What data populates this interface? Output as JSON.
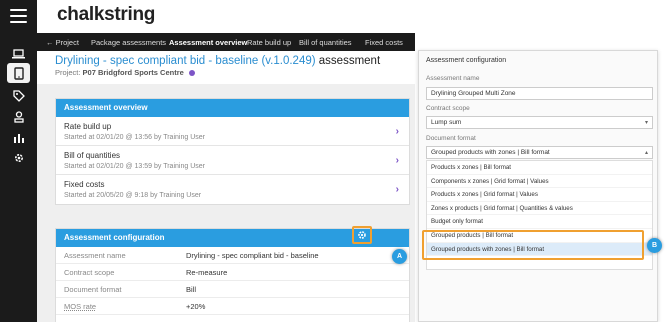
{
  "brand": "chalkstring",
  "nav": {
    "items": [
      "← Project",
      "Package assessments",
      "Assessment overview",
      "Rate build up",
      "Bill of quantities",
      "Fixed costs"
    ]
  },
  "header": {
    "title": "Drylining - spec compliant bid - baseline (v.1.0.249)",
    "title_suffix": "assessment",
    "project_label": "Project:",
    "project_name": "P07 Bridgford Sports Centre"
  },
  "overview": {
    "heading": "Assessment overview",
    "items": [
      {
        "title": "Rate build up",
        "subtitle": "Started at 02/01/20 @ 13:56 by Training User"
      },
      {
        "title": "Bill of quantities",
        "subtitle": "Started at 02/01/20 @ 13:59 by Training User"
      },
      {
        "title": "Fixed costs",
        "subtitle": "Started at 20/05/20 @ 9:18 by Training User"
      }
    ]
  },
  "config": {
    "heading": "Assessment configuration",
    "rows": [
      {
        "key": "Assessment name",
        "value": "Drylining - spec compliant bid - baseline"
      },
      {
        "key": "Contract scope",
        "value": "Re-measure"
      },
      {
        "key": "Document format",
        "value": "Bill"
      },
      {
        "key": "MOS rate",
        "value": "+20%"
      }
    ]
  },
  "popup": {
    "title": "Assessment configuration",
    "name_label": "Assessment name",
    "name_value": "Drylining Grouped Multi Zone",
    "scope_label": "Contract scope",
    "scope_value": "Lump sum",
    "format_label": "Document format",
    "format_value": "Grouped products with zones | Bill format",
    "options": [
      "Products x zones | Bill format",
      "Components x zones | Grid format | Values",
      "Products x zones | Grid format | Values",
      "Zones x products | Grid format | Quantities & values",
      "Budget only format",
      "Grouped products | Bill format",
      "Grouped products with zones | Bill format"
    ],
    "selected_index": 6
  },
  "callouts": {
    "a": "A",
    "b": "B"
  },
  "colors": {
    "accent": "#2a9de0",
    "highlight": "#f0a030",
    "purple": "#7d55c7",
    "rail": "#1b1b1b"
  },
  "icons": [
    "menu-icon",
    "laptop-icon",
    "tablet-icon",
    "tag-icon",
    "user-badge-icon",
    "bar-chart-icon",
    "gear-icon",
    "chevron-right-icon"
  ]
}
